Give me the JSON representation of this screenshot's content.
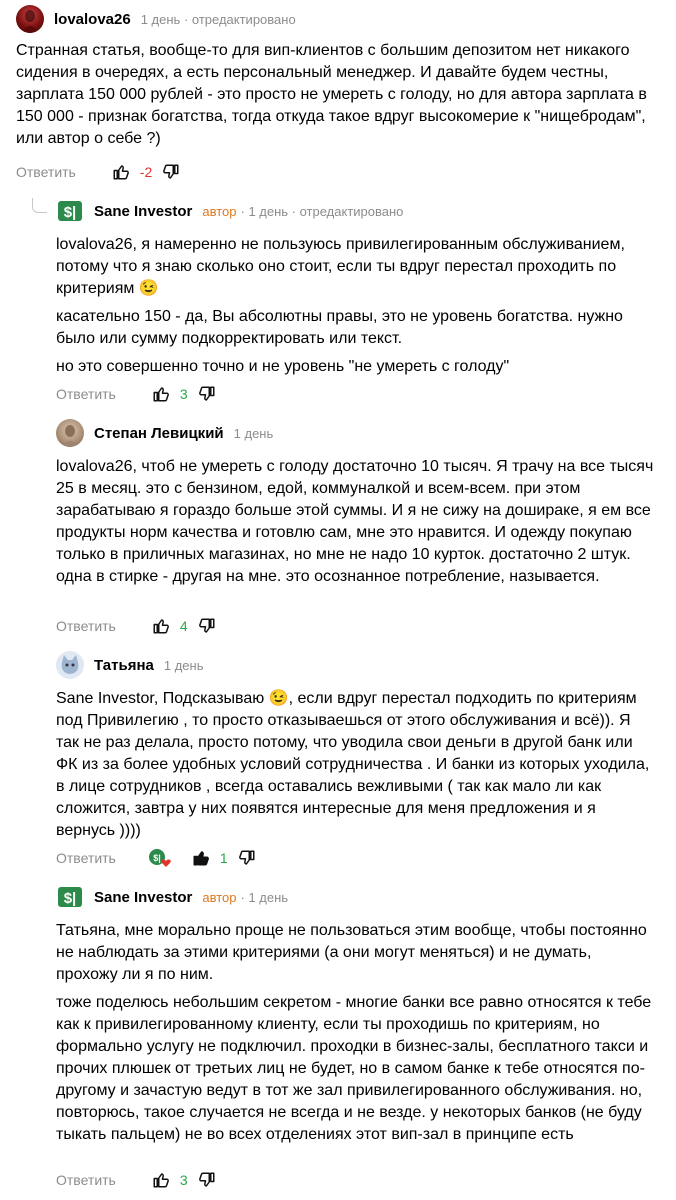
{
  "c1": {
    "author": "lovalova26",
    "meta": "1 день · отредактировано",
    "paragraphs": [
      "Странная статья, вообще-то для вип-клиентов с большим депозитом нет никакого сидения в очередях, а есть персональный менеджер. И давайте будем честны, зарплата 150 000 рублей - это просто не умереть с голоду, но для автора зарплата в 150 000 - признак богатства, тогда откуда такое вдруг высокомерие к \"нищебродам\", или автор о себе ?)"
    ],
    "reply": "Ответить",
    "score": "-2"
  },
  "c2": {
    "author": "Sane Investor",
    "badge": "автор",
    "meta": "· 1 день · отредактировано",
    "paragraphs": [
      "lovalova26, я намеренно не пользуюсь привилегированным обслуживанием, потому что я знаю сколько оно стоит, если ты вдруг перестал проходить по критериям 😉",
      "касательно 150 - да, Вы абсолютны правы, это не уровень богатства. нужно было или сумму подкорректировать или текст.",
      "но это совершенно точно и не уровень \"не умереть с голоду\""
    ],
    "reply": "Ответить",
    "score": "3"
  },
  "c3": {
    "author": "Степан Левицкий",
    "meta": "1 день",
    "paragraphs": [
      "lovalova26, чтоб не умереть с голоду достаточно 10 тысяч. Я трачу на все тысяч 25 в месяц. это с бензином, едой, коммуналкой и всем-всем. при этом зарабатываю я гораздо больше этой суммы. И я не сижу на дошираке, я ем все продукты норм качества и готовлю сам, мне это нравится. И одежду покупаю только в приличных магазинах, но мне не надо 10 курток. достаточно 2 штук. одна в стирке - другая на мне. это осознанное потребление, называется."
    ],
    "reply": "Ответить",
    "score": "4"
  },
  "c4": {
    "author": "Татьяна",
    "meta": "1 день",
    "paragraphs": [
      "Sane Investor, Подсказываю 😉, если вдруг перестал подходить по критериям под Привилегию , то просто отказываешься от этого обслуживания и всё)). Я так не раз делала, просто потому, что уводила свои деньги в другой банк или ФК из за более удобных условий сотрудничества . И банки из которых уходила, в лице сотрудников , всегда оставались вежливыми ( так как мало ли как сложится, завтра у них появятся интересные для меня предложения и я вернусь ))))"
    ],
    "reply": "Ответить",
    "score": "1"
  },
  "c5": {
    "author": "Sane Investor",
    "badge": "автор",
    "meta": "· 1 день",
    "paragraphs": [
      "Татьяна, мне морально проще не пользоваться этим вообще, чтобы постоянно не наблюдать за этими критериями (а они могут меняться) и не думать, прохожу ли я по ним.",
      "тоже поделюсь небольшим секретом - многие банки все равно относятся к тебе как к привилегированному клиенту, если ты проходишь по критериям, но формально услугу не подключил. проходки в бизнес-залы, бесплатного такси и прочих плюшек от третьих лиц не будет, но в самом банке к тебе относятся по-другому и зачастую ведут в тот же зал привилегированного обслуживания. но, повторюсь, такое случается не всегда и не везде. у некоторых банков (не буду тыкать пальцем) не во всех отделениях этот вип-зал в принципе есть"
    ],
    "reply": "Ответить",
    "score": "3"
  },
  "colors": {
    "negative": "#e0352b",
    "positive": "#2aa84a",
    "muted": "#8c8c8c",
    "author_badge": "#e0781e"
  },
  "icons": [
    "thumb-up-icon",
    "thumb-down-icon",
    "author-liked-icon",
    "avatar-sane-investor-logo"
  ]
}
